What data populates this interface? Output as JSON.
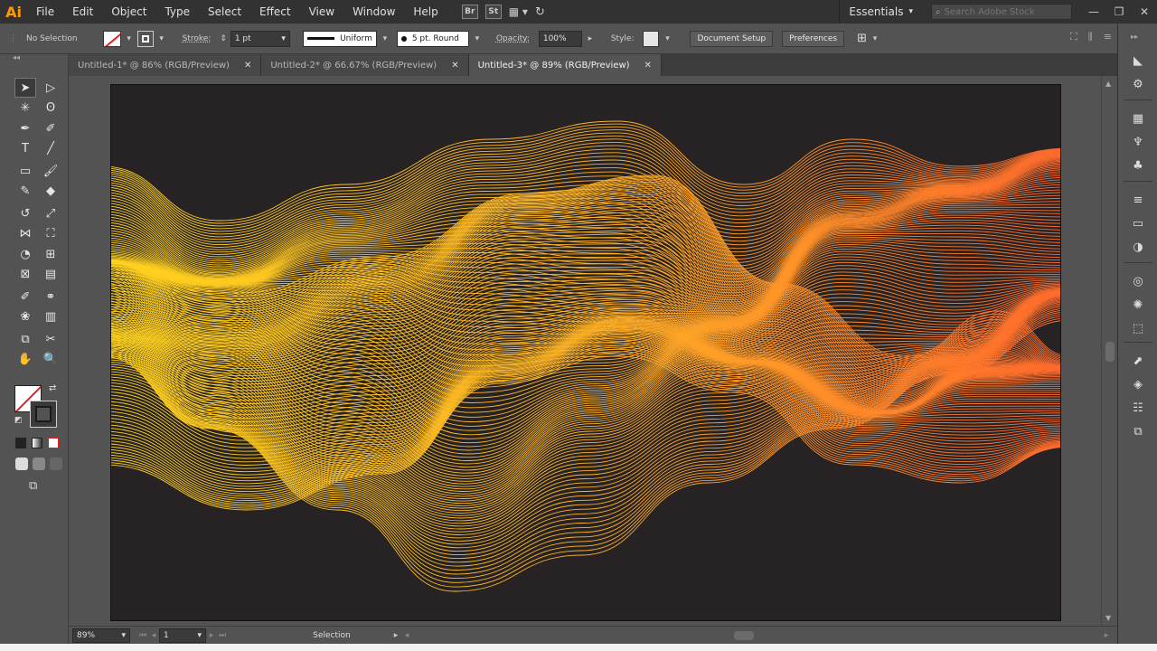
{
  "app": {
    "logo": "Ai",
    "accent": "#ff9a00"
  },
  "menubar": {
    "items": [
      "File",
      "Edit",
      "Object",
      "Type",
      "Select",
      "Effect",
      "View",
      "Window",
      "Help"
    ],
    "bridge_label": "Br",
    "stock_label": "St",
    "workspace": "Essentials",
    "search_placeholder": "Search Adobe Stock"
  },
  "controlbar": {
    "selection": "No Selection",
    "stroke_label": "Stroke:",
    "stroke_weight": "1 pt",
    "profile": "Uniform",
    "brush": "5 pt. Round",
    "opacity_label": "Opacity:",
    "opacity_value": "100%",
    "style_label": "Style:",
    "document_setup": "Document Setup",
    "preferences": "Preferences"
  },
  "tabs": [
    {
      "label": "Untitled-1* @ 86% (RGB/Preview)",
      "active": false
    },
    {
      "label": "Untitled-2* @ 66.67% (RGB/Preview)",
      "active": false
    },
    {
      "label": "Untitled-3* @ 89% (RGB/Preview)",
      "active": true
    }
  ],
  "statusbar": {
    "zoom": "89%",
    "page": "1",
    "status": "Selection"
  },
  "tools": [
    "selection-tool-icon",
    "direct-selection-tool-icon",
    "magic-wand-tool-icon",
    "lasso-tool-icon",
    "pen-tool-icon",
    "curvature-tool-icon",
    "type-tool-icon",
    "line-segment-tool-icon",
    "rectangle-tool-icon",
    "paintbrush-tool-icon",
    "pencil-tool-icon",
    "eraser-tool-icon",
    "rotate-tool-icon",
    "scale-tool-icon",
    "width-tool-icon",
    "free-transform-tool-icon",
    "shape-builder-tool-icon",
    "perspective-grid-tool-icon",
    "mesh-tool-icon",
    "gradient-tool-icon",
    "eyedropper-tool-icon",
    "blend-tool-icon",
    "symbol-sprayer-tool-icon",
    "column-graph-tool-icon",
    "artboard-tool-icon",
    "slice-tool-icon",
    "hand-tool-icon",
    "zoom-tool-icon"
  ],
  "artwork": {
    "background": "#272324",
    "gradient_start": "#ffd21e",
    "gradient_mid": "#ffb224",
    "gradient_end": "#ff6a2c"
  }
}
